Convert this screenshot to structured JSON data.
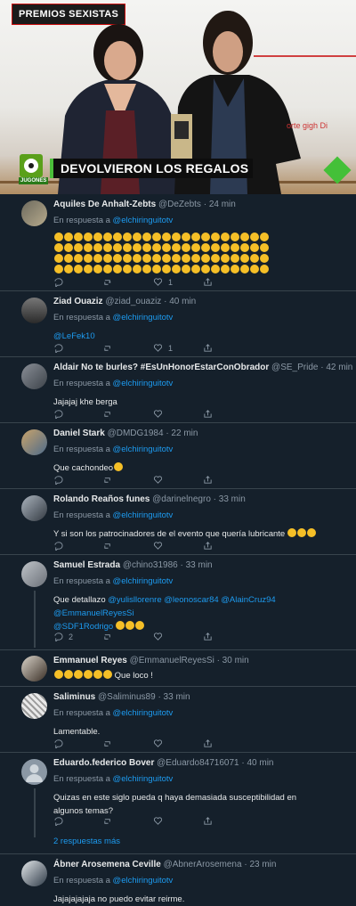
{
  "hero": {
    "badge": "PREMIOS SEXISTAS",
    "ticker": "DEVOLVIERON LOS REGALOS",
    "logo_label": "JUGONES",
    "sponsor": "orte  gigh  Di"
  },
  "icons": [
    "reply-icon",
    "retweet-icon",
    "like-icon",
    "share-icon"
  ],
  "colors": {
    "background": "#15202b",
    "link": "#1d9bf0",
    "muted": "#8b98a5",
    "divider": "#38444d"
  },
  "tweets": [
    {
      "name": "Aquiles De Anhalt-Zebts",
      "handle": "@DeZebts",
      "time": "· 24 min",
      "reply_prefix": "En respuesta a",
      "reply_to": "@elchiringuitotv",
      "emoji_rows": [
        22,
        22,
        22,
        22
      ],
      "likes": "1"
    },
    {
      "name": "Ziad Ouaziz",
      "handle": "@ziad_ouaziz",
      "time": "· 40 min",
      "reply_prefix": "En respuesta a",
      "reply_to": "@elchiringuitotv",
      "text": "@LeFek10",
      "likes": "1"
    },
    {
      "name": "Aldair No te burles? #EsUnHonorEstarConObrador",
      "handle": "@SE_Pride",
      "time": "· 42 min",
      "reply_prefix": "En respuesta a",
      "reply_to": "@elchiringuitotv",
      "text": "Jajajaj khe berga"
    },
    {
      "name": "Daniel Stark",
      "handle": "@DMDG1984",
      "time": "· 22 min",
      "reply_prefix": "En respuesta a",
      "reply_to": "@elchiringuitotv",
      "text": "Que cachondeo"
    },
    {
      "name": "Rolando Reaños funes",
      "handle": "@darinelnegro",
      "time": "· 33 min",
      "reply_prefix": "En respuesta a",
      "reply_to": "@elchiringuitotv",
      "text": "Y si son los patrocinadores de el evento que quería lubricante"
    },
    {
      "name": "Samuel Estrada",
      "handle": "@chino31986",
      "time": "· 33 min",
      "reply_prefix": "En respuesta a",
      "reply_to": "@elchiringuitotv",
      "text_prefix": "Que detallazo",
      "mentions": "@yulisllorenre @leonoscar84 @AlainCruz94 @EmmanuelReyesSi",
      "mentions2": "@SDF1Rodrigo",
      "replies": "2"
    },
    {
      "name": "Emmanuel Reyes",
      "handle": "@EmmanuelReyesSi",
      "time": "· 30 min",
      "text": "Que loco !"
    },
    {
      "name": "Saliminus",
      "handle": "@Saliminus89",
      "time": "· 33 min",
      "reply_prefix": "En respuesta a",
      "reply_to": "@elchiringuitotv",
      "text": "Lamentable."
    },
    {
      "name": "Eduardo.federico Bover",
      "handle": "@Eduardo84716071",
      "time": "· 40 min",
      "reply_prefix": "En respuesta a",
      "reply_to": "@elchiringuitotv",
      "text": "Quizas en este siglo pueda q haya demasiada susceptibilidad en algunos temas?",
      "more": "2 respuestas más"
    },
    {
      "name": "Ábner Arosemena Ceville",
      "handle": "@AbnerArosemena",
      "time": "· 23 min",
      "reply_prefix": "En respuesta a",
      "reply_to": "@elchiringuitotv",
      "text": "Jajajajajaja no puedo evitar reirme."
    }
  ]
}
